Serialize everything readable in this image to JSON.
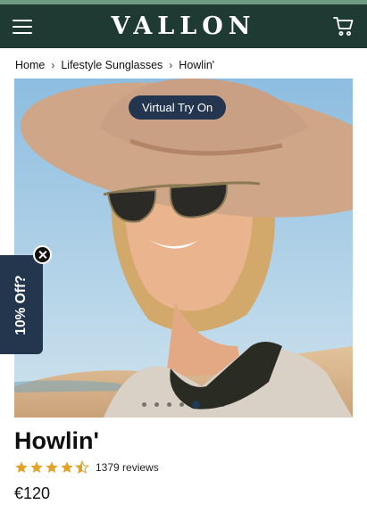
{
  "header": {
    "logo": "VALLON",
    "menu_icon": "hamburger-menu-icon",
    "cart_icon": "cart-icon",
    "background_color": "#1e3a32"
  },
  "breadcrumb": {
    "items": [
      "Home",
      "Lifestyle Sunglasses",
      "Howlin'"
    ]
  },
  "hero": {
    "try_on_label": "Virtual Try On",
    "carousel_slide_count": 7,
    "carousel_active_index": 4
  },
  "discount_tab": {
    "label": "10% Off?",
    "close_icon": "close-icon"
  },
  "product": {
    "title": "Howlin'",
    "rating": 4.5,
    "reviews": "1379 reviews",
    "price": "€120",
    "star_color": "#e0a229"
  }
}
